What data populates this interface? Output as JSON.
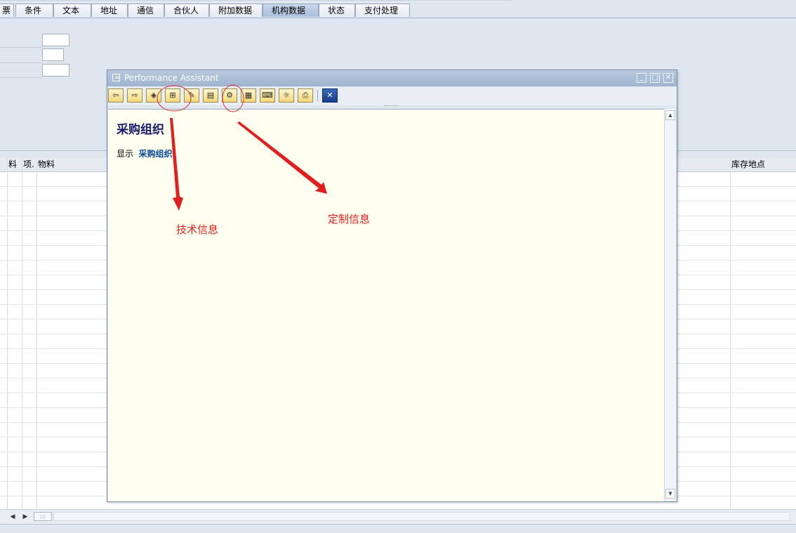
{
  "tabs": [
    {
      "label": "票"
    },
    {
      "label": "条件"
    },
    {
      "label": "文本"
    },
    {
      "label": "地址"
    },
    {
      "label": "通信"
    },
    {
      "label": "合伙人"
    },
    {
      "label": "附加数据"
    },
    {
      "label": "机构数据",
      "active": true
    },
    {
      "label": "状态"
    },
    {
      "label": "支付处理"
    }
  ],
  "grid": {
    "columns": [
      {
        "label": ""
      },
      {
        "label": "料"
      },
      {
        "label": "项."
      },
      {
        "label": "物料"
      },
      {
        "label": "库存地点"
      }
    ]
  },
  "dialog": {
    "title": "Performance Assistant",
    "toolbar": [
      {
        "icon": "back-arrow-icon"
      },
      {
        "icon": "forward-arrow-icon"
      },
      {
        "icon": "glossary-book-icon"
      },
      {
        "icon": "technical-info-icon"
      },
      {
        "icon": "edit-note-icon"
      },
      {
        "icon": "sticky-notes-icon"
      },
      {
        "icon": "customizing-info-icon"
      },
      {
        "icon": "table-of-contents-icon"
      },
      {
        "icon": "keyboard-icon"
      },
      {
        "icon": "settings-icon"
      },
      {
        "icon": "print-icon"
      },
      {
        "icon": "close-icon"
      }
    ],
    "content": {
      "heading": "采购组织",
      "text_prefix": "显示",
      "link_text": "采购组织",
      "text_suffix": "。"
    }
  },
  "annotations": {
    "technical_info": "技术信息",
    "customizing_info": "定制信息",
    "color": "#e02020"
  },
  "colors": {
    "background": "#dfe6ef",
    "dialog_content": "#fffff0",
    "heading": "#1a1a6e",
    "link": "#0a4a9c"
  }
}
